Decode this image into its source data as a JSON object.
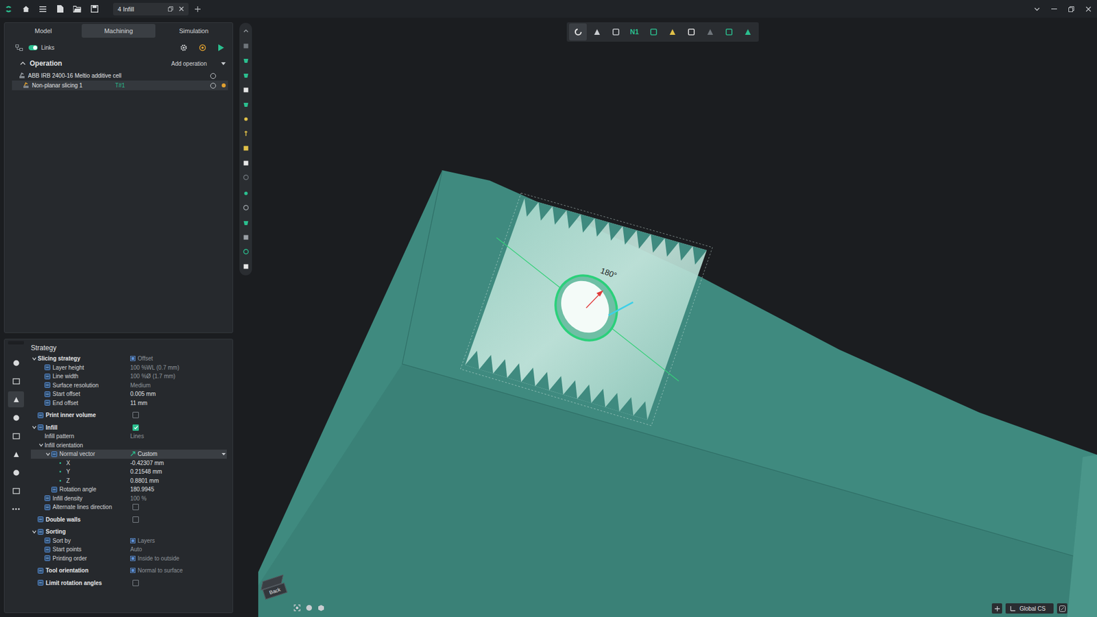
{
  "window": {
    "title": "4 Infill"
  },
  "panel_tabs": [
    {
      "label": "Model",
      "selected": false
    },
    {
      "label": "Machining",
      "selected": true
    },
    {
      "label": "Simulation",
      "selected": false
    }
  ],
  "links": {
    "label": "Links",
    "on": true
  },
  "operations": {
    "title": "Operation",
    "expanded": true,
    "add_label": "Add operation",
    "items": [
      {
        "name": "ABB IRB 2400-16 Meltio additive cell",
        "tag": "",
        "selected": false,
        "modified": false,
        "level": 0
      },
      {
        "name": "Non-planar slicing 1",
        "tag": "T#1",
        "selected": true,
        "modified": true,
        "level": 1
      }
    ]
  },
  "property_pages": [
    {
      "selected": false
    },
    {
      "selected": false
    },
    {
      "selected": true
    },
    {
      "selected": false
    },
    {
      "selected": false
    },
    {
      "selected": false
    },
    {
      "selected": false
    },
    {
      "selected": false
    },
    {
      "selected": false
    }
  ],
  "strategy": {
    "title": "Strategy",
    "rows": [
      {
        "label": "Slicing strategy",
        "level": 0,
        "kind": "value",
        "value": "Offset",
        "value_icon": true,
        "greyed": true,
        "expandable": true,
        "expanded": true,
        "icon": false,
        "selected": false
      },
      {
        "label": "Layer height",
        "level": 1,
        "kind": "value",
        "value": "100 %WL (0.7 mm)",
        "value_icon": false,
        "greyed": true,
        "expandable": false,
        "icon": true,
        "selected": false
      },
      {
        "label": "Line width",
        "level": 1,
        "kind": "value",
        "value": "100 %Ø (1.7 mm)",
        "value_icon": false,
        "greyed": true,
        "expandable": false,
        "icon": true,
        "selected": false
      },
      {
        "label": "Surface resolution",
        "level": 1,
        "kind": "value",
        "value": "Medium",
        "value_icon": false,
        "greyed": true,
        "expandable": false,
        "icon": true,
        "selected": false
      },
      {
        "label": "Start offset",
        "level": 1,
        "kind": "value",
        "value": "0.005 mm",
        "value_icon": false,
        "greyed": false,
        "expandable": false,
        "icon": true,
        "selected": false
      },
      {
        "label": "End offset",
        "level": 1,
        "kind": "value",
        "value": "11 mm",
        "value_icon": false,
        "greyed": false,
        "expandable": false,
        "icon": true,
        "selected": false
      },
      {
        "label": "Print inner volume",
        "level": 0,
        "kind": "checkbox",
        "checked": false,
        "expandable": false,
        "icon": true,
        "selected": false
      },
      {
        "label": "Infill",
        "level": 0,
        "kind": "checkbox",
        "checked": true,
        "expandable": true,
        "expanded": true,
        "icon": true,
        "selected": false
      },
      {
        "label": "Infill pattern",
        "level": 1,
        "kind": "value",
        "value": "Lines",
        "value_icon": false,
        "greyed": true,
        "expandable": false,
        "icon": false,
        "selected": false
      },
      {
        "label": "Infill orientation",
        "level": 1,
        "kind": "none",
        "expandable": true,
        "expanded": true,
        "icon": false,
        "selected": false
      },
      {
        "label": "Normal vector",
        "level": 2,
        "kind": "dropdown",
        "value": "Custom",
        "value_icon": true,
        "greyed": false,
        "expandable": true,
        "expanded": true,
        "icon": true,
        "selected": true
      },
      {
        "label": "X",
        "level": 3,
        "kind": "value",
        "value": "-0.42307 mm",
        "value_icon": false,
        "greyed": false,
        "expandable": false,
        "icon": true,
        "selected": false
      },
      {
        "label": "Y",
        "level": 3,
        "kind": "value",
        "value": "0.21548 mm",
        "value_icon": false,
        "greyed": false,
        "expandable": false,
        "icon": true,
        "selected": false
      },
      {
        "label": "Z",
        "level": 3,
        "kind": "value",
        "value": "0.8801 mm",
        "value_icon": false,
        "greyed": false,
        "expandable": false,
        "icon": true,
        "selected": false
      },
      {
        "label": "Rotation angle",
        "level": 2,
        "kind": "value",
        "value": "180.9945",
        "value_icon": false,
        "greyed": false,
        "expandable": false,
        "icon": true,
        "selected": false
      },
      {
        "label": "Infill density",
        "level": 1,
        "kind": "value",
        "value": "100 %",
        "value_icon": false,
        "greyed": true,
        "expandable": false,
        "icon": true,
        "selected": false
      },
      {
        "label": "Alternate lines direction",
        "level": 1,
        "kind": "checkbox",
        "checked": false,
        "expandable": false,
        "icon": true,
        "selected": false
      },
      {
        "label": "Double walls",
        "level": 0,
        "kind": "checkbox",
        "checked": false,
        "expandable": false,
        "icon": true,
        "selected": false
      },
      {
        "label": "Sorting",
        "level": 0,
        "kind": "none",
        "expandable": true,
        "expanded": true,
        "icon": true,
        "selected": false
      },
      {
        "label": "Sort by",
        "level": 1,
        "kind": "value",
        "value": "Layers",
        "value_icon": true,
        "greyed": true,
        "expandable": false,
        "icon": true,
        "selected": false
      },
      {
        "label": "Start points",
        "level": 1,
        "kind": "value",
        "value": "Auto",
        "value_icon": false,
        "greyed": true,
        "expandable": false,
        "icon": true,
        "selected": false
      },
      {
        "label": "Printing order",
        "level": 1,
        "kind": "value",
        "value": "Inside to outside",
        "value_icon": true,
        "greyed": true,
        "expandable": false,
        "icon": true,
        "selected": false
      },
      {
        "label": "Tool orientation",
        "level": 0,
        "kind": "value",
        "value": "Normal to surface",
        "value_icon": true,
        "greyed": true,
        "expandable": false,
        "icon": true,
        "selected": false
      },
      {
        "label": "Limit rotation angles",
        "level": 0,
        "kind": "checkbox",
        "checked": false,
        "expandable": false,
        "icon": true,
        "selected": false
      }
    ]
  },
  "view_toolbar": [
    {
      "label": "",
      "selected": true
    },
    {
      "label": "",
      "selected": false
    },
    {
      "label": "",
      "selected": false
    },
    {
      "label": "N1",
      "selected": false
    },
    {
      "label": "",
      "selected": false
    },
    {
      "label": "",
      "selected": false
    },
    {
      "label": "",
      "selected": false
    },
    {
      "label": "",
      "selected": false
    },
    {
      "label": "",
      "selected": false
    },
    {
      "label": "",
      "selected": false
    }
  ],
  "viewport": {
    "angle_label": "180°",
    "view_cube_label": "Back",
    "coordinate_system": "Global CS"
  }
}
